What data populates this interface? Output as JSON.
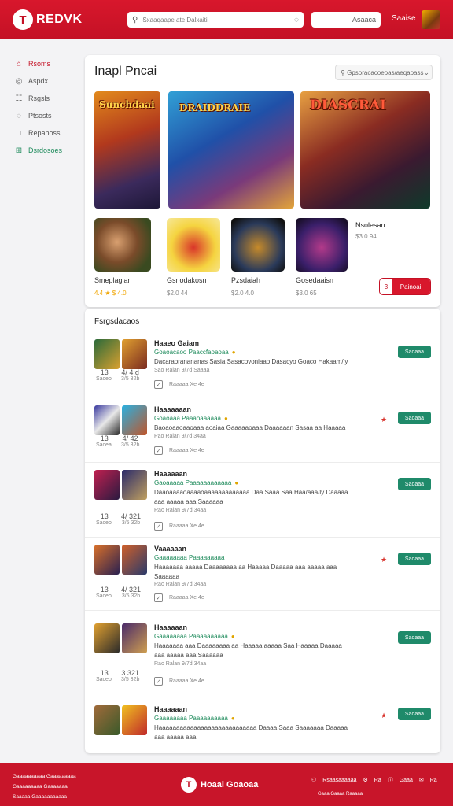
{
  "header": {
    "logo_mark": "T",
    "logo_text": "REDVK",
    "search_placeholder": "Sxaaqaape ate Dalxaiti",
    "search2_text": "Asaaca",
    "user_label": "Saaise"
  },
  "sidebar": {
    "items": [
      {
        "icon": "⌂",
        "label": "Rsoms"
      },
      {
        "icon": "◎",
        "label": "Aspdx"
      },
      {
        "icon": "☷",
        "label": "Rsgsls"
      },
      {
        "icon": "◌",
        "label": "Ptsosts"
      },
      {
        "icon": "□",
        "label": "Repahoss"
      },
      {
        "icon": "⊞",
        "label": "Dsrdosoes"
      }
    ]
  },
  "featured": {
    "title": "Inapl Pncai",
    "select_text": "Gpsoracacoeoas/aeqaoass",
    "big_captions": [
      "Sunchdaai",
      "DRAIDDRAIE",
      "DIASCRAI"
    ],
    "small_games": [
      {
        "name": "Smeplagian",
        "meta": "4.4 ★ $ 4.0"
      },
      {
        "name": "Gsnodakosn",
        "meta": "$2.0  44"
      },
      {
        "name": "Pzsdaiah",
        "meta": "$2.0  4.0"
      },
      {
        "name": "Gosedaaisn",
        "meta": "$3.0  65"
      }
    ],
    "side_name": "Nsolesan",
    "side_price": "$3.0  94",
    "buy_left": "3",
    "buy_right": "Painoaii"
  },
  "recommendations": {
    "title": "Fsrgsdacaos",
    "rows": [
      {
        "stat1": "13",
        "stat1_sub": "Saceoi",
        "stat2": "4/ 4:d",
        "stat2_sub": "3/5 32b",
        "name": "Haaeo Gaiam",
        "sub": "Goaoacaoo Paaccfaoaoaa",
        "desc": "Dacaraoranananas Sasia Sasacovoniaao Dasacyo Goaco Hakaam/ly",
        "tiny": "Sao Ralan 9/7d Saaaa",
        "meta": "Raaaaa  Xe  4e",
        "star": false,
        "btn": "Saoaaa"
      },
      {
        "stat1": "13",
        "stat1_sub": "Saceai",
        "stat2": "4/ 42",
        "stat2_sub": "3/5 32b",
        "name": "Haaaaaaan",
        "sub": "Goaoaaa Paaaoaaaaaa",
        "desc": "Baoaoaaoaaoaaa aoaiaa Gaaaaaoaaa Daaaaaan Sasaa aa Haaaaa",
        "tiny": "Pao Ralan 9/7d 34aa",
        "meta": "Raaaaa  Xe  4e",
        "star": true,
        "btn": "Saoaaa"
      },
      {
        "stat1": "13",
        "stat1_sub": "Saceoi",
        "stat2": "4/ 321",
        "stat2_sub": "3/5 32b",
        "name": "Haaaaaan",
        "sub": "Gaoaaaaa Paaaaaaaaaaaa",
        "desc": "Daaoaaaaoaaaaoaaaaaaaaaaaaa Daa Saaa Saa Haa/aaa/ly Daaaaa aaa aaaaa aaa Saaaaaa",
        "tiny": "Rao Ralan 9/7d 34aa",
        "meta": "Raaaaa  Xe  4e",
        "star": false,
        "btn": "Saoaaa"
      },
      {
        "stat1": "13",
        "stat1_sub": "Saceoi",
        "stat2": "4/ 321",
        "stat2_sub": "3/5 32b",
        "name": "Vaaaaaan",
        "sub": "Gaaaaaaaa Paaaaaaaaa",
        "desc": "Haaaaaaa aaaaa Daaaaaaaa aa Haaaaa Daaaaa aaa aaaaa aaa Saaaaaa",
        "tiny": "Rao Ralan 9/7d 34aa",
        "meta": "Raaaaa  Xe  4e",
        "star": true,
        "btn": "Saoaaa"
      },
      {
        "stat1": "13",
        "stat1_sub": "Saceoi",
        "stat2": "3  321",
        "stat2_sub": "3/5 32b",
        "name": "Haaaaaan",
        "sub": "Gaaaaaaaa Paaaaaaaaaa",
        "desc": "Haaaaaaa aaa Daaaaaaaa aa Haaaaa aaaaa Saa Haaaaa Daaaaa aaa aaaaa aaa Saaaaaa",
        "tiny": "Rao Ralan 9/7d 34aa",
        "meta": "Raaaaa  Xe  4e",
        "star": false,
        "btn": "Saoaaa"
      },
      {
        "stat1": "13",
        "stat1_sub": "Saceoi",
        "stat2": "4/ 321",
        "stat2_sub": "3/5 32b",
        "name": "Haaaaaan",
        "sub": "Gaaaaaaaa Paaaaaaaaaa",
        "desc": "Haaaaaaaaaaaaaaaaaaaaaaaaaaaa Daaaa Saaa Saaaaaaa Daaaaa aaa aaaaa aaa",
        "tiny": "",
        "meta": "",
        "star": true,
        "btn": "Saoaaa"
      }
    ]
  },
  "footer": {
    "lines": [
      "Gaaaaaaaaaa Gaaaaaaaaa",
      "Gaaaaaaaaa Gaaaaaaa",
      "Saaaaa Gaaaaaaaaaaa"
    ],
    "logo_mark": "T",
    "logo_text": "Hoaal Goaoaa",
    "links": [
      "Rsaasaaaaaa",
      "Ra",
      "Gaaa",
      "Ra"
    ],
    "small": "Gaaa Gaaaa Raaaaa"
  }
}
